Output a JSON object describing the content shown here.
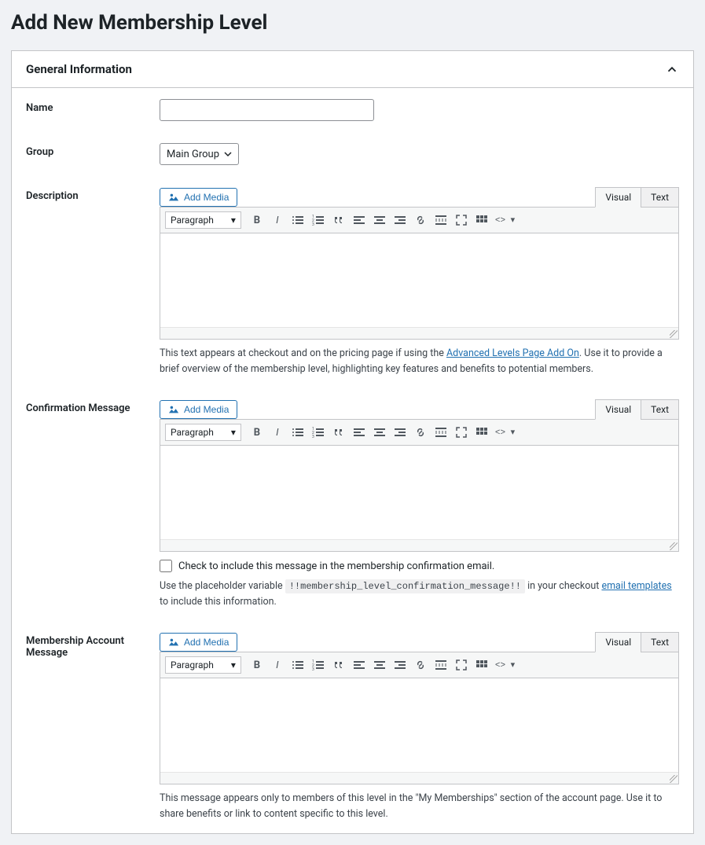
{
  "page": {
    "title": "Add New Membership Level"
  },
  "panel": {
    "title": "General Information"
  },
  "labels": {
    "name": "Name",
    "group": "Group",
    "description": "Description",
    "confirmation": "Confirmation Message",
    "account_message": "Membership Account Message"
  },
  "group": {
    "selected": "Main Group"
  },
  "editor": {
    "add_media": "Add Media",
    "tab_visual": "Visual",
    "tab_text": "Text",
    "paragraph": "Paragraph"
  },
  "description_help": {
    "pre": "This text appears at checkout and on the pricing page if using the ",
    "link": "Advanced Levels Page Add On",
    "post": ". Use it to provide a brief overview of the membership level, highlighting key features and benefits to potential members."
  },
  "confirmation": {
    "checkbox_label": "Check to include this message in the membership confirmation email.",
    "help_pre": "Use the placeholder variable ",
    "code": "!!membership_level_confirmation_message!!",
    "help_mid": " in your checkout ",
    "link": "email templates",
    "help_post": " to include this information."
  },
  "account_message_help": "This message appears only to members of this level in the \"My Memberships\" section of the account page. Use it to share benefits or link to content specific to this level."
}
